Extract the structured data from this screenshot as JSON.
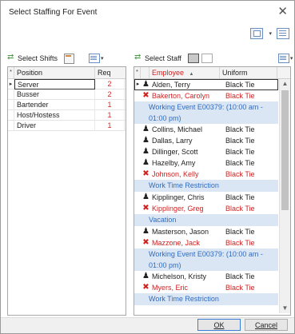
{
  "window": {
    "title": "Select Staffing For Event",
    "close_glyph": "✕"
  },
  "top_icons": [
    "layout-icon",
    "grid-settings-icon"
  ],
  "left_toolbar": {
    "select_shifts": "Select Shifts"
  },
  "right_toolbar": {
    "select_staff": "Select Staff"
  },
  "positions": {
    "headers": {
      "position": "Position",
      "req": "Req"
    },
    "rows": [
      {
        "position": "Server",
        "req": "2"
      },
      {
        "position": "Busser",
        "req": "2"
      },
      {
        "position": "Bartender",
        "req": "1"
      },
      {
        "position": "Host/Hostess",
        "req": "1"
      },
      {
        "position": "Driver",
        "req": "1"
      }
    ]
  },
  "staff": {
    "headers": {
      "employee": "Employee",
      "uniform": "Uniform"
    },
    "rows": [
      {
        "name": "Alden, Terry",
        "uniform": "Black Tie",
        "conflict": false
      },
      {
        "name": "Bakerton, Carolyn",
        "uniform": "Black Tie",
        "conflict": true
      },
      {
        "note": "Working Event E00379: (10:00 am - 01:00 pm)"
      },
      {
        "name": "Collins, Michael",
        "uniform": "Black Tie",
        "conflict": false
      },
      {
        "name": "Dallas, Larry",
        "uniform": "Black Tie",
        "conflict": false
      },
      {
        "name": "Dillinger, Scott",
        "uniform": "Black Tie",
        "conflict": false
      },
      {
        "name": "Hazelby, Amy",
        "uniform": "Black Tie",
        "conflict": false
      },
      {
        "name": "Johnson, Kelly",
        "uniform": "Black Tie",
        "conflict": true
      },
      {
        "note": "Work Time Restriction"
      },
      {
        "name": "Kipplinger, Chris",
        "uniform": "Black Tie",
        "conflict": false
      },
      {
        "name": "Kipplinger, Greg",
        "uniform": "Black Tie",
        "conflict": true
      },
      {
        "note": "Vacation"
      },
      {
        "name": "Masterson, Jason",
        "uniform": "Black Tie",
        "conflict": false
      },
      {
        "name": "Mazzone, Jack",
        "uniform": "Black Tie",
        "conflict": true
      },
      {
        "note": "Working Event E00379: (10:00 am - 01:00 pm)"
      },
      {
        "name": "Michelson, Kristy",
        "uniform": "Black Tie",
        "conflict": false
      },
      {
        "name": "Myers, Eric",
        "uniform": "Black Tie",
        "conflict": true
      },
      {
        "note": "Work Time Restriction"
      }
    ]
  },
  "footer": {
    "ok": "OK",
    "cancel": "Cancel"
  },
  "colors": {
    "conflict_red": "#d32020",
    "note_blue": "#2f6cc0",
    "note_bg": "#dbe6f4"
  }
}
